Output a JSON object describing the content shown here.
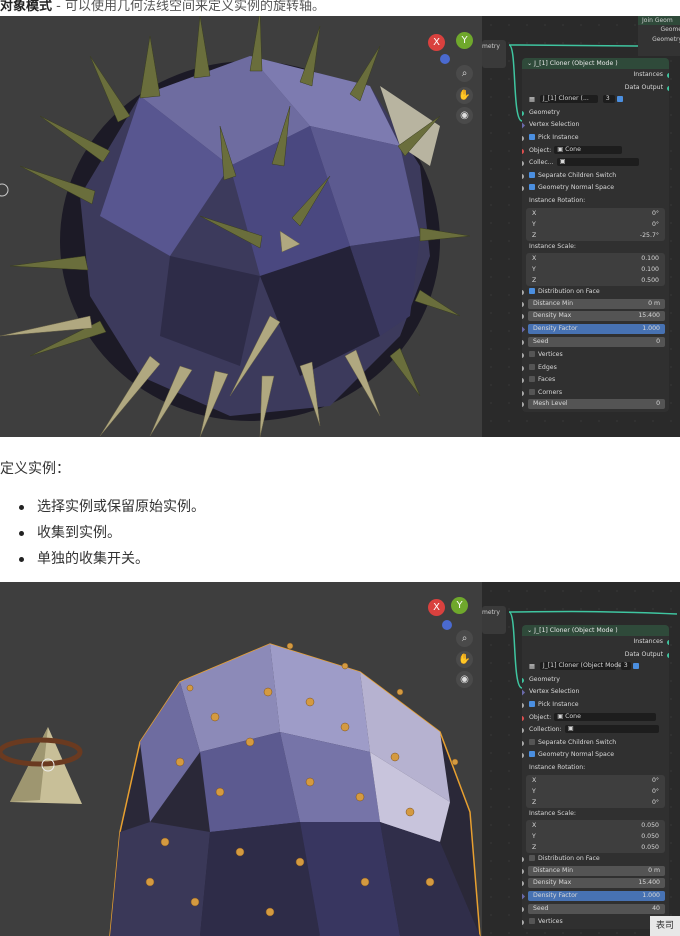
{
  "caption": {
    "bold": "对象模式",
    "rest": " - 可以使用几何法线空间来定义实例的旋转轴。"
  },
  "section_intro": "定义实例：",
  "bullets": [
    "选择实例或保留原始实例。",
    "收集到实例。",
    "单独的收集开关。"
  ],
  "colors": {
    "accent": "#4772b3",
    "socket_geometry": "#3fc5a0",
    "node_header": "#2f4a3a",
    "selection_outline": "#e8a030"
  },
  "viewport_nav": {
    "axis_x": "X",
    "axis_y": "Y",
    "zoom_icon": "zoom-icon",
    "hand_icon": "hand-icon",
    "camera_icon": "camera-icon"
  },
  "shot1": {
    "left_node_label": "metry",
    "join_node": {
      "title": "Join Geom",
      "row1": "Geome",
      "row2": "Geometry"
    },
    "node": {
      "title": "J_[1] Cloner (Object Mode )",
      "out_instances": "Instances",
      "out_data": "Data Output",
      "datablock": "J_[1] Cloner (...",
      "datablock_users": "3",
      "in_geometry": "Geometry",
      "vertex_selection": "Vertex Selection",
      "pick_instance": "Pick Instance",
      "object_label": "Object:",
      "object_value": "Cone",
      "collection_label": "Collec...",
      "sep_children": "Separate Children Switch",
      "geo_normal": "Geometry Normal Space",
      "rot_label": "Instance Rotation:",
      "rot": [
        {
          "k": "X",
          "v": "0°"
        },
        {
          "k": "Y",
          "v": "0°"
        },
        {
          "k": "Z",
          "v": "-25.7°"
        }
      ],
      "scale_label": "Instance Scale:",
      "scale": [
        {
          "k": "X",
          "v": "0.100"
        },
        {
          "k": "Y",
          "v": "0.100"
        },
        {
          "k": "Z",
          "v": "0.500"
        }
      ],
      "dist_face": "Distribution on Face",
      "dist_min_label": "Distance Min",
      "dist_min": "0 m",
      "density_max_label": "Density Max",
      "density_max": "15.400",
      "density_factor_label": "Density Factor",
      "density_factor": "1.000",
      "seed_label": "Seed",
      "seed": "0",
      "vertices": "Vertices",
      "edges": "Edges",
      "faces": "Faces",
      "corners": "Corners",
      "mesh_level_label": "Mesh Level",
      "mesh_level": "0"
    }
  },
  "shot2": {
    "left_node_label": "metry",
    "node": {
      "title": "J_[1] Cloner (Object Mode )",
      "out_instances": "Instances",
      "out_data": "Data Output",
      "datablock": "J_[1] Cloner (Object Mode )",
      "datablock_users": "3",
      "in_geometry": "Geometry",
      "vertex_selection": "Vertex Selection",
      "pick_instance": "Pick Instance",
      "object_label": "Object:",
      "object_value": "Cone",
      "collection_label": "Collection:",
      "sep_children": "Separate Children Switch",
      "geo_normal": "Geometry Normal Space",
      "rot_label": "Instance Rotation:",
      "rot": [
        {
          "k": "X",
          "v": "0°"
        },
        {
          "k": "Y",
          "v": "0°"
        },
        {
          "k": "Z",
          "v": "0°"
        }
      ],
      "scale_label": "Instance Scale:",
      "scale": [
        {
          "k": "X",
          "v": "0.050"
        },
        {
          "k": "Y",
          "v": "0.050"
        },
        {
          "k": "Z",
          "v": "0.050"
        }
      ],
      "dist_face": "Distribution on Face",
      "dist_min_label": "Distance Min",
      "dist_min": "0 m",
      "density_max_label": "Density Max",
      "density_max": "15.400",
      "density_factor_label": "Density Factor",
      "density_factor": "1.000",
      "seed_label": "Seed",
      "seed": "40",
      "vertices": "Vertices",
      "watermark": "表司"
    }
  }
}
